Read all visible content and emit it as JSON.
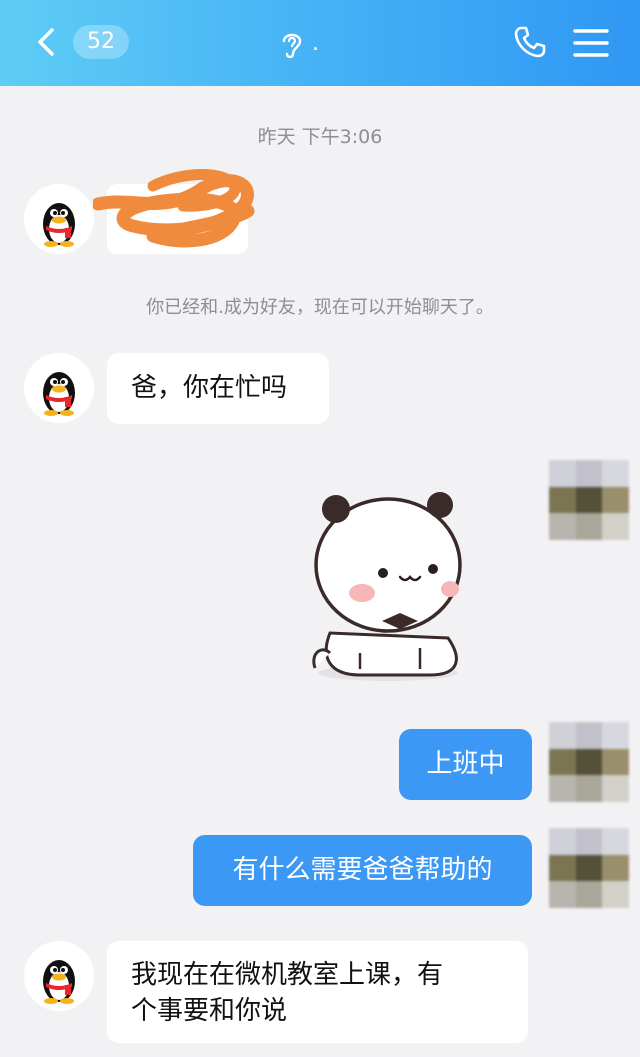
{
  "header": {
    "unread_count": "52",
    "title": "."
  },
  "messages": {
    "timestamp": "昨天 下午3:06",
    "system_note": "你已经和.成为好友，现在可以开始聊天了。",
    "incoming_1": "爸，你在忙吗",
    "outgoing_1": "上班中",
    "outgoing_2": "有什么需要爸爸帮助的",
    "incoming_2_line1": "我现在在微机教室上课，有",
    "incoming_2_line2": "个事要和你说"
  },
  "icons": {
    "back": "chevron-left-icon",
    "voice": "ear-icon",
    "call": "phone-icon",
    "menu": "hamburger-menu-icon",
    "sticker": "panda-bear-sticker"
  },
  "colors": {
    "header_gradient_start": "#5ecdf5",
    "header_gradient_end": "#2f97f4",
    "outgoing_bubble": "#3b98f5",
    "incoming_bubble": "#ffffff",
    "background": "#f2f2f4",
    "scribble": "#f08a3c"
  }
}
